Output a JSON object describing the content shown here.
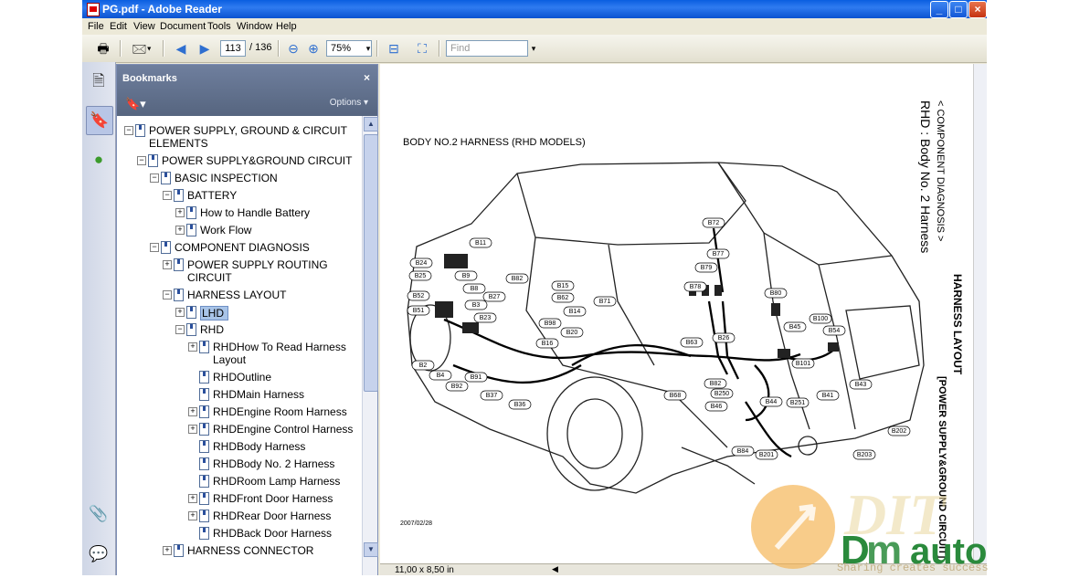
{
  "window": {
    "title": "PG.pdf - Adobe Reader",
    "controls": [
      "_",
      "□",
      "×"
    ]
  },
  "menu": [
    "File",
    "Edit",
    "View",
    "Document",
    "Tools",
    "Window",
    "Help"
  ],
  "toolbar": {
    "page_current": "113",
    "page_total": "/ 136",
    "zoom": "75%",
    "find_placeholder": "Find"
  },
  "bookmarks": {
    "title": "Bookmarks",
    "close": "×",
    "options": "Options ▾",
    "items": [
      {
        "label": "POWER SUPPLY, GROUND & CIRCUIT",
        "label2": "ELEMENTS",
        "toggle": "−",
        "level": 0
      },
      {
        "label": "POWER SUPPLY&GROUND CIRCUIT",
        "toggle": "−",
        "level": 1
      },
      {
        "label": "BASIC INSPECTION",
        "toggle": "−",
        "level": 2
      },
      {
        "label": "BATTERY",
        "toggle": "−",
        "level": 3
      },
      {
        "label": "How to Handle Battery",
        "toggle": "+",
        "level": 4
      },
      {
        "label": "Work Flow",
        "toggle": "+",
        "level": 4
      },
      {
        "label": "COMPONENT DIAGNOSIS",
        "toggle": "−",
        "level": 2
      },
      {
        "label": "POWER SUPPLY ROUTING",
        "label2": "CIRCUIT",
        "toggle": "+",
        "level": 3
      },
      {
        "label": "HARNESS LAYOUT",
        "toggle": "−",
        "level": 3
      },
      {
        "label": "LHD",
        "toggle": "+",
        "level": 4,
        "selected": true
      },
      {
        "label": "RHD",
        "toggle": "−",
        "level": 4
      },
      {
        "label": "RHDHow To Read Harness",
        "label2": "Layout",
        "toggle": "+",
        "level": 5
      },
      {
        "label": "RHDOutline",
        "toggle": "",
        "level": 5
      },
      {
        "label": "RHDMain Harness",
        "toggle": "",
        "level": 5
      },
      {
        "label": "RHDEngine Room Harness",
        "toggle": "+",
        "level": 5
      },
      {
        "label": "RHDEngine Control Harness",
        "toggle": "+",
        "level": 5
      },
      {
        "label": "RHDBody Harness",
        "toggle": "",
        "level": 5
      },
      {
        "label": "RHDBody No. 2 Harness",
        "toggle": "",
        "level": 5
      },
      {
        "label": "RHDRoom Lamp Harness",
        "toggle": "",
        "level": 5
      },
      {
        "label": "RHDFront Door Harness",
        "toggle": "+",
        "level": 5
      },
      {
        "label": "RHDRear Door Harness",
        "toggle": "+",
        "level": 5
      },
      {
        "label": "RHDBack Door Harness",
        "toggle": "",
        "level": 5
      },
      {
        "label": "HARNESS CONNECTOR",
        "toggle": "+",
        "level": 3
      }
    ]
  },
  "document": {
    "diagram_title": "BODY NO.2 HARNESS (RHD MODELS)",
    "side_header_1": "< COMPONENT DIAGNOSIS >",
    "side_header_2": "RHD : Body No. 2 Harness",
    "side_header_3": "HARNESS LAYOUT",
    "side_header_4": "[POWER SUPPLY&GROUND CIRCUIT]",
    "date": "2007/02/28",
    "connectors": [
      "B72",
      "B77",
      "B79",
      "B78",
      "B11",
      "B24",
      "B25",
      "B9",
      "B82",
      "B15",
      "B62",
      "B14",
      "B52",
      "B8",
      "B27",
      "B3",
      "B71",
      "B80",
      "B51",
      "B23",
      "B98",
      "B20",
      "B100",
      "B45",
      "B54",
      "B63",
      "B26",
      "B16",
      "B2",
      "B4",
      "B91",
      "B101",
      "B92",
      "B37",
      "B36",
      "B68",
      "B82",
      "B250",
      "B46",
      "B44",
      "B251",
      "B41",
      "B43",
      "B202",
      "B84",
      "B201",
      "B203"
    ]
  },
  "status": {
    "page_size": "11,00 x 8,50 in"
  },
  "watermark": {
    "brand": "auto",
    "tagline": "Sharing creates success"
  }
}
